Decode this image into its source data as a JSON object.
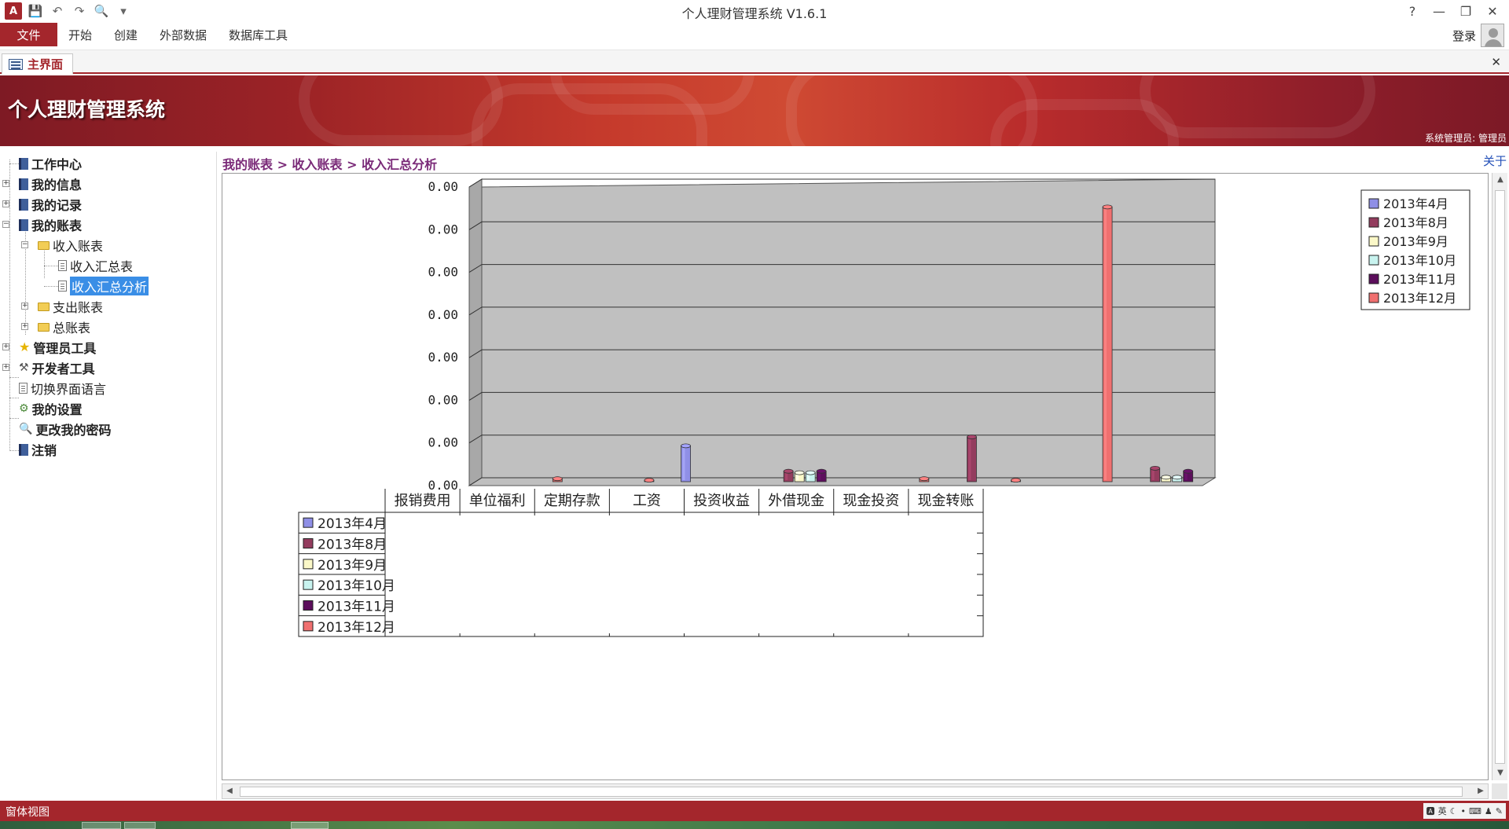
{
  "window": {
    "title": "个人理财管理系统 V1.6.1",
    "help": "?",
    "minimize": "—",
    "restore": "❐",
    "close": "✕"
  },
  "qat": {
    "logo": "A",
    "save": "💾",
    "undo": "↶",
    "redo": "↷",
    "preview": "🔍",
    "customize": "▾"
  },
  "ribbon": {
    "file": "文件",
    "tabs": [
      "开始",
      "创建",
      "外部数据",
      "数据库工具"
    ],
    "login": "登录"
  },
  "doc_tab": {
    "label": "主界面",
    "close": "✕"
  },
  "banner": {
    "title": "个人理财管理系统",
    "admin": "系统管理员: 管理员"
  },
  "nav": {
    "items": [
      {
        "label": "工作中心"
      },
      {
        "label": "我的信息"
      },
      {
        "label": "我的记录"
      },
      {
        "label": "我的账表"
      },
      {
        "label": "收入账表"
      },
      {
        "label": "收入汇总表"
      },
      {
        "label": "收入汇总分析"
      },
      {
        "label": "支出账表"
      },
      {
        "label": "总账表"
      },
      {
        "label": "管理员工具"
      },
      {
        "label": "开发者工具"
      },
      {
        "label": "切换界面语言"
      },
      {
        "label": "我的设置"
      },
      {
        "label": "更改我的密码"
      },
      {
        "label": "注销"
      }
    ]
  },
  "breadcrumb": "我的账表 > 收入账表 > 收入汇总分析",
  "about": "关于",
  "chart_data": {
    "type": "bar",
    "style": "3d-cylinder",
    "categories": [
      "报销费用",
      "单位福利",
      "定期存款",
      "工资",
      "投资收益",
      "外借现金",
      "现金投资",
      "现金转账"
    ],
    "y_tick_labels": [
      "0.00",
      "0.00",
      "0.00",
      "0.00",
      "0.00",
      "0.00",
      "0.00",
      "0.00"
    ],
    "ylim": [
      0,
      1
    ],
    "grid": true,
    "legend_position": "top-right",
    "data_table": true,
    "series": [
      {
        "name": "2013年4月",
        "color": "#8f8fe6",
        "values": [
          0,
          0,
          0.12,
          0,
          0,
          0,
          0,
          0
        ]
      },
      {
        "name": "2013年8月",
        "color": "#933c5e",
        "values": [
          0,
          0,
          0,
          0.035,
          0,
          0.15,
          0,
          0.045
        ]
      },
      {
        "name": "2013年9月",
        "color": "#fbf8c8",
        "values": [
          0,
          0,
          0,
          0.03,
          0,
          0,
          0,
          0.015
        ]
      },
      {
        "name": "2013年10月",
        "color": "#c8f3ef",
        "values": [
          0,
          0,
          0,
          0.03,
          0,
          0,
          0,
          0.015
        ]
      },
      {
        "name": "2013年11月",
        "color": "#5c0e5c",
        "values": [
          0,
          0,
          0,
          0.035,
          0,
          0,
          0,
          0.035
        ]
      },
      {
        "name": "2013年12月",
        "color": "#f07070",
        "values": [
          0.01,
          0.005,
          0,
          0,
          0.01,
          0.005,
          0.92,
          0
        ]
      }
    ]
  },
  "status": {
    "view": "窗体视图",
    "ime": "英"
  }
}
